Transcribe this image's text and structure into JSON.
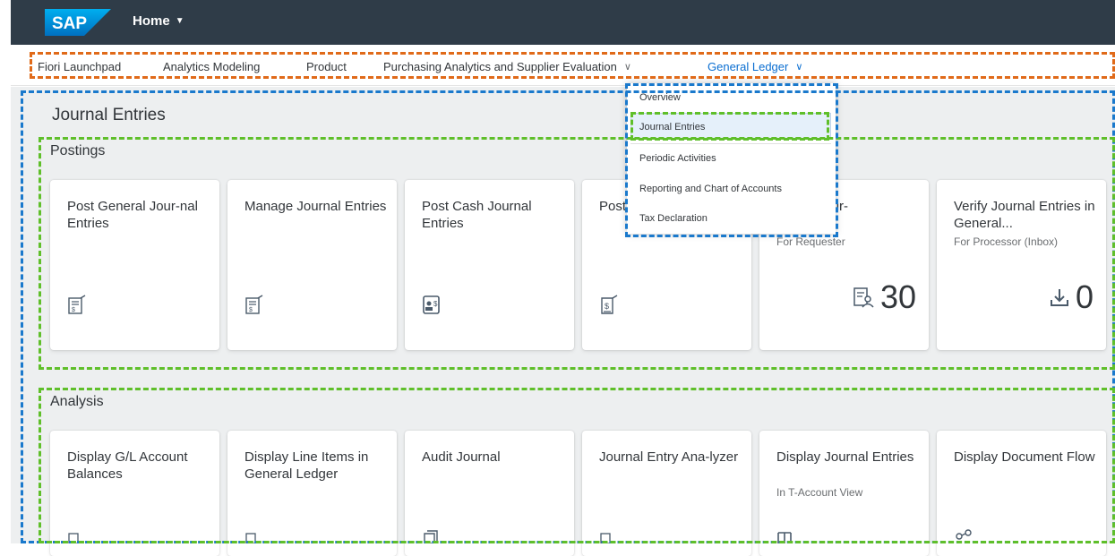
{
  "shell": {
    "logo_text": "SAP",
    "home_label": "Home"
  },
  "nav": {
    "items": [
      "Fiori Launchpad",
      "Analytics Modeling",
      "Product",
      "Purchasing Analytics and Supplier Evaluation",
      "General Ledger"
    ]
  },
  "page": {
    "title": "Journal Entries"
  },
  "postings": {
    "title": "Postings",
    "tiles": [
      {
        "title": "Post General Jour-nal Entries",
        "subtitle": "",
        "icon": "post-document-icon"
      },
      {
        "title": "Manage Journal Entries",
        "subtitle": "",
        "icon": "post-document-icon"
      },
      {
        "title": "Post Cash Journal Entries",
        "subtitle": "",
        "icon": "cash-journal-icon"
      },
      {
        "title": "Post Adju",
        "subtitle": "",
        "icon": "adjustment-icon"
      },
      {
        "title": "eneral Jour-",
        "subtitle": "For Requester",
        "kpi": "30",
        "icon": "requester-icon"
      },
      {
        "title": "Verify Journal Entries in General...",
        "subtitle": "For Processor (Inbox)",
        "kpi": "0",
        "icon": "download-icon"
      }
    ]
  },
  "analysis": {
    "title": "Analysis",
    "tiles": [
      {
        "title": "Display G/L Account Balances",
        "subtitle": ""
      },
      {
        "title": "Display Line Items in General Ledger",
        "subtitle": ""
      },
      {
        "title": "Audit Journal",
        "subtitle": ""
      },
      {
        "title": "Journal Entry Ana-lyzer",
        "subtitle": ""
      },
      {
        "title": "Display Journal Entries",
        "subtitle": "In T-Account View"
      },
      {
        "title": "Display Document Flow",
        "subtitle": ""
      }
    ]
  },
  "dropdown": {
    "items": [
      "Overview",
      "Journal Entries",
      "Periodic Activities",
      "Reporting and Chart of Accounts",
      "Tax Declaration"
    ],
    "selected": "Journal Entries"
  },
  "colors": {
    "shell": "#2f3c48",
    "accent": "#0a6ed1",
    "orange": "#e06a19",
    "blue": "#1a79cc",
    "green": "#5fbf2a"
  }
}
